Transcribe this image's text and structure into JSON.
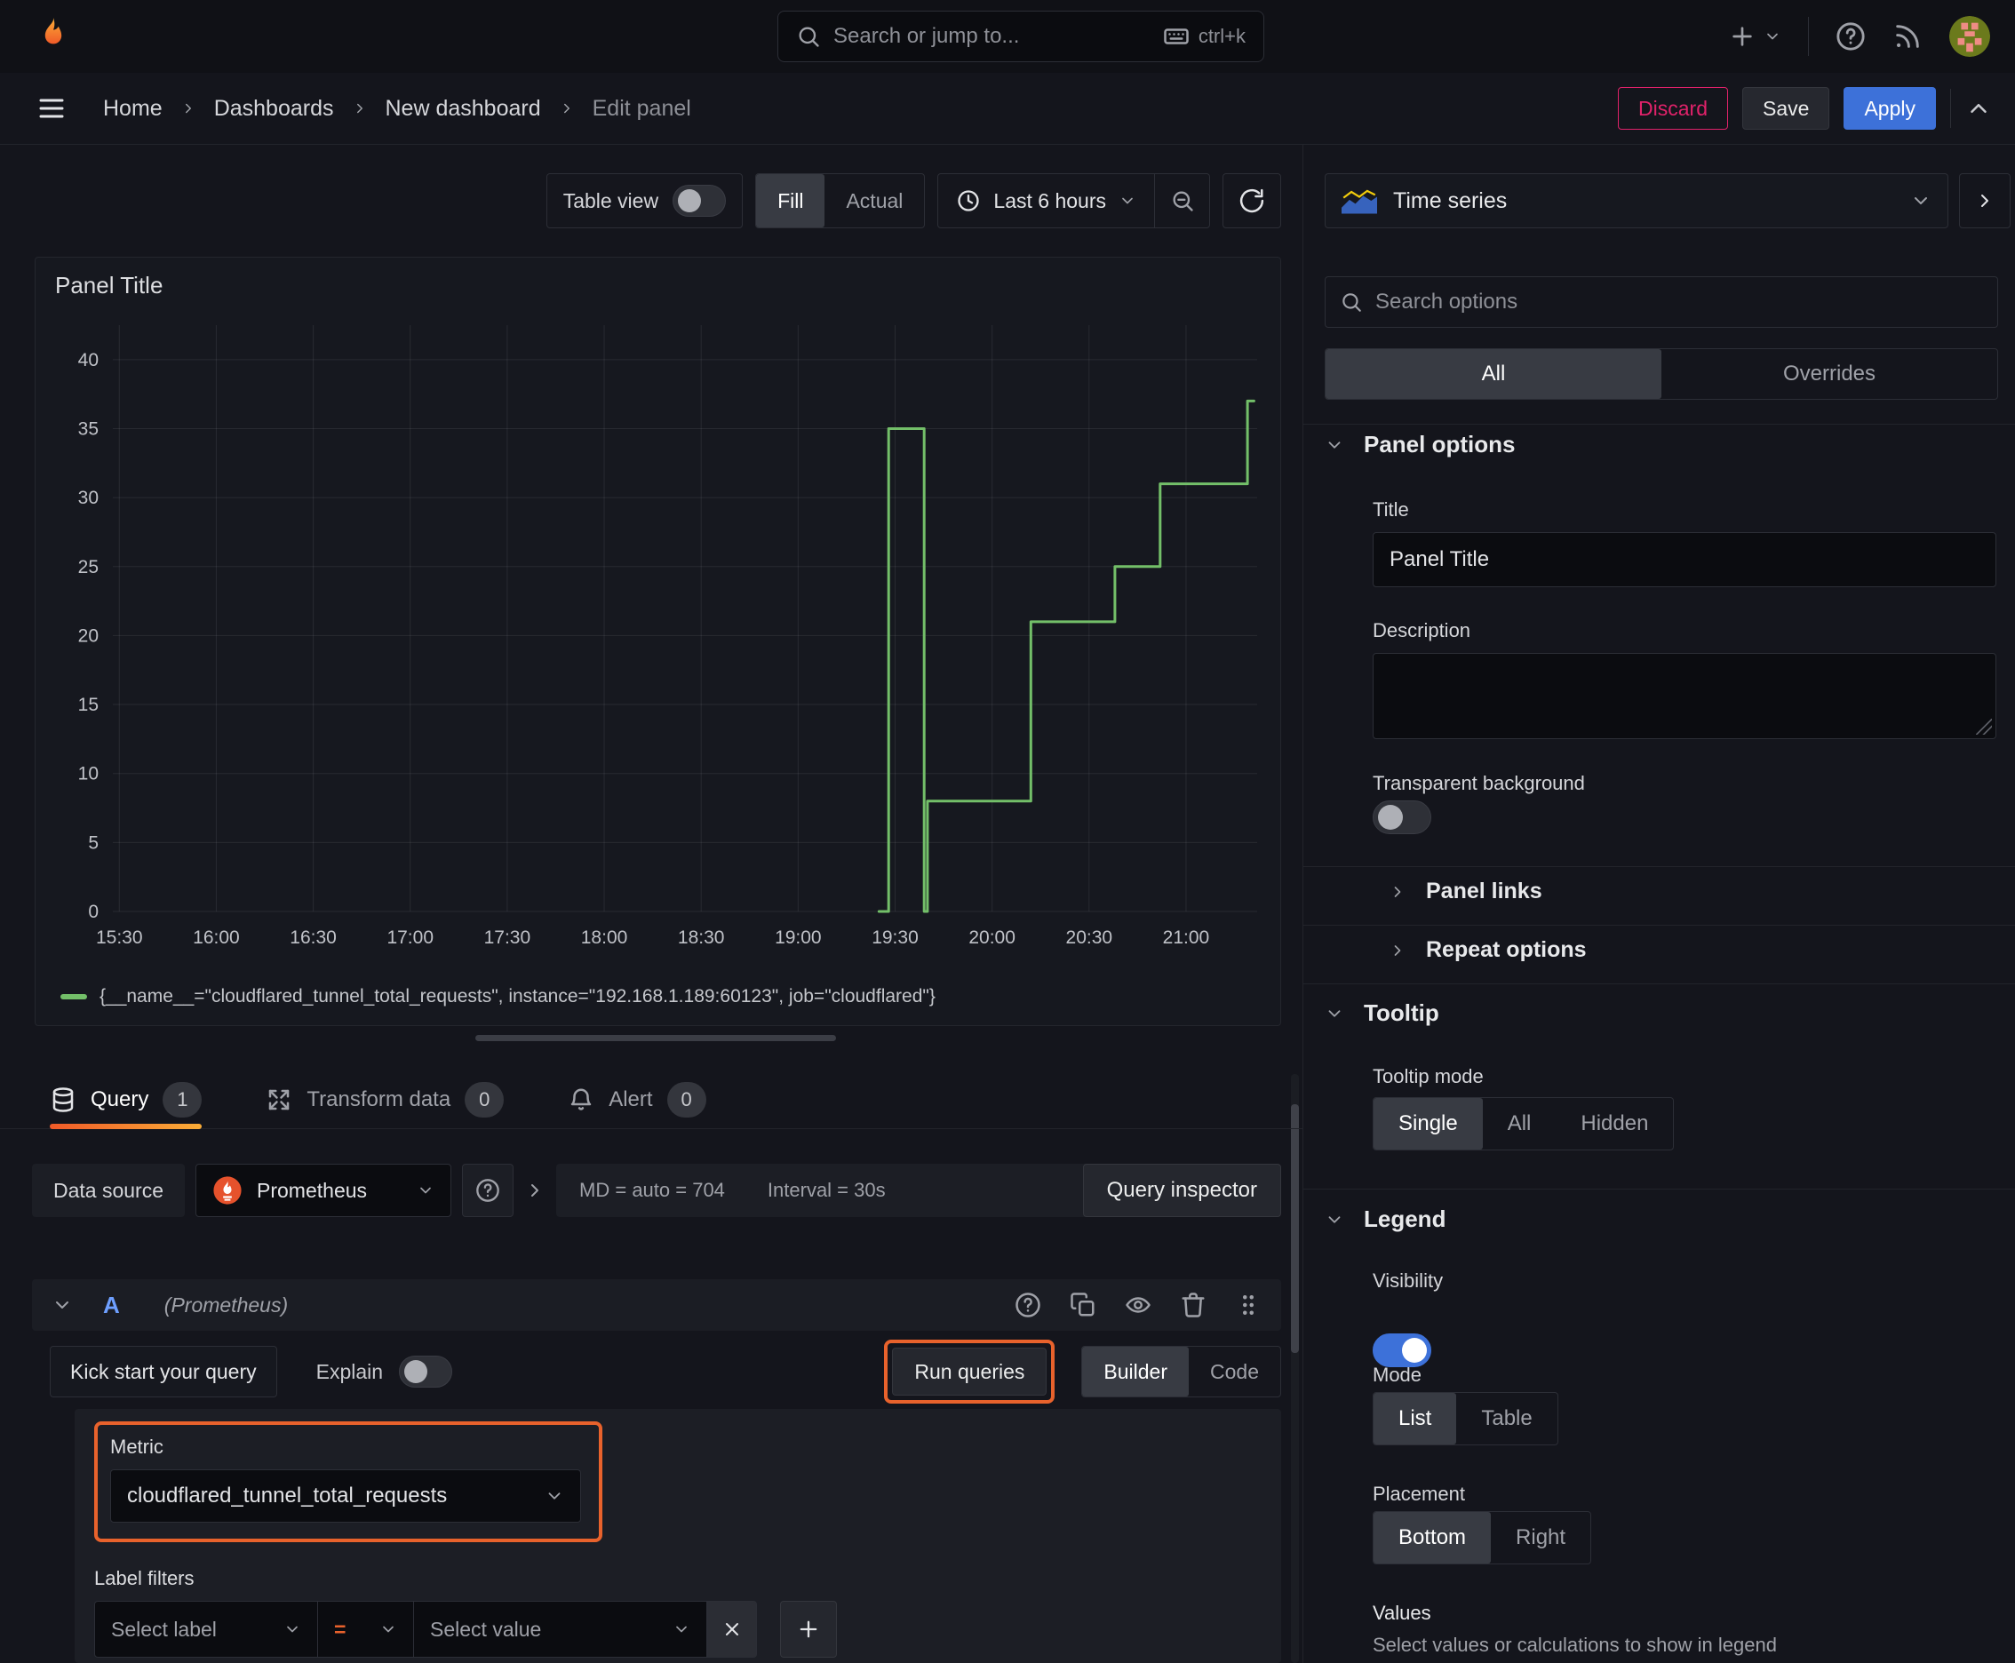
{
  "topbar": {
    "search_placeholder": "Search or jump to...",
    "shortcut": "ctrl+k"
  },
  "breadcrumb": {
    "items": [
      "Home",
      "Dashboards",
      "New dashboard"
    ],
    "current": "Edit panel",
    "discard": "Discard",
    "save": "Save",
    "apply": "Apply"
  },
  "toolbar": {
    "table_view": "Table view",
    "fill": "Fill",
    "actual": "Actual",
    "time_range": "Last 6 hours"
  },
  "chart_data": {
    "type": "line",
    "title": "Panel Title",
    "xlabel": "",
    "ylabel": "",
    "x_ticks": [
      "15:30",
      "16:00",
      "16:30",
      "17:00",
      "17:30",
      "18:00",
      "18:30",
      "19:00",
      "19:30",
      "20:00",
      "20:30",
      "21:00"
    ],
    "y_ticks": [
      0,
      5,
      10,
      15,
      20,
      25,
      30,
      35,
      40
    ],
    "x_range": [
      "15:28",
      "21:22"
    ],
    "ylim": [
      0,
      42.5
    ],
    "grid": true,
    "legend_position": "bottom",
    "series": [
      {
        "name": "{__name__=\"cloudflared_tunnel_total_requests\", instance=\"192.168.1.189:60123\", job=\"cloudflared\"}",
        "color": "#73bf69",
        "points": [
          [
            "19:25",
            0
          ],
          [
            "19:28",
            0
          ],
          [
            "19:28",
            35
          ],
          [
            "19:39",
            35
          ],
          [
            "19:39",
            0
          ],
          [
            "19:40",
            0
          ],
          [
            "19:40",
            8
          ],
          [
            "20:12",
            8
          ],
          [
            "20:12",
            21
          ],
          [
            "20:38",
            21
          ],
          [
            "20:38",
            25
          ],
          [
            "20:52",
            25
          ],
          [
            "20:52",
            31
          ],
          [
            "21:19",
            31
          ],
          [
            "21:19",
            37
          ],
          [
            "21:21",
            37
          ]
        ]
      }
    ]
  },
  "query_tabs": {
    "query": "Query",
    "query_count": "1",
    "transform": "Transform data",
    "transform_count": "0",
    "alert": "Alert",
    "alert_count": "0"
  },
  "datasource_row": {
    "label": "Data source",
    "value": "Prometheus",
    "stats_md": "MD = auto = 704",
    "stats_interval": "Interval = 30s",
    "inspector": "Query inspector"
  },
  "query_editor": {
    "ref_id": "A",
    "ds_hint": "(Prometheus)",
    "kick_start": "Kick start your query",
    "explain": "Explain",
    "run_queries": "Run queries",
    "builder": "Builder",
    "code": "Code",
    "metric_label": "Metric",
    "metric_value": "cloudflared_tunnel_total_requests",
    "label_filters": "Label filters",
    "select_label": "Select label",
    "operator": "=",
    "select_value": "Select value"
  },
  "options": {
    "viz_type": "Time series",
    "search_placeholder": "Search options",
    "tab_all": "All",
    "tab_overrides": "Overrides",
    "panel_options": "Panel options",
    "title_label": "Title",
    "title_value": "Panel Title",
    "description_label": "Description",
    "transparent": "Transparent background",
    "panel_links": "Panel links",
    "repeat_options": "Repeat options",
    "tooltip": "Tooltip",
    "tooltip_mode": "Tooltip mode",
    "tooltip_single": "Single",
    "tooltip_all": "All",
    "tooltip_hidden": "Hidden",
    "legend": "Legend",
    "visibility": "Visibility",
    "mode": "Mode",
    "mode_list": "List",
    "mode_table": "Table",
    "placement": "Placement",
    "placement_bottom": "Bottom",
    "placement_right": "Right",
    "values_label": "Values",
    "values_help": "Select values or calculations to show in legend"
  },
  "colors": {
    "accent_blue": "#3d71d9",
    "accent_orange": "#e8622c",
    "series_green": "#73bf69",
    "discard_pink": "#e0226a",
    "tab_underline_from": "#f05a28",
    "tab_underline_to": "#fbad37"
  }
}
